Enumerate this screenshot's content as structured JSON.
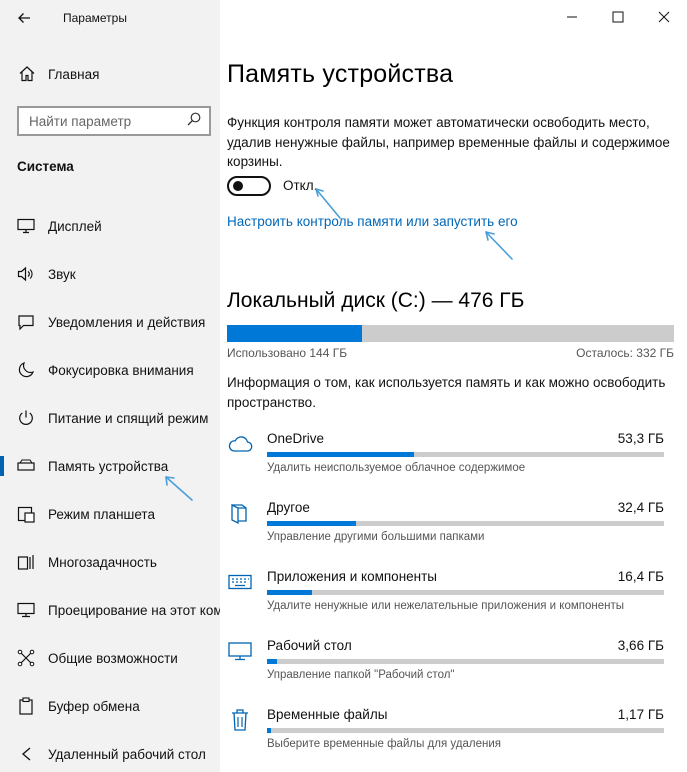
{
  "app": {
    "title": "Параметры"
  },
  "sidebar": {
    "home_label": "Главная",
    "search_placeholder": "Найти параметр",
    "section_title": "Система",
    "items": [
      {
        "label": "Дисплей",
        "icon": "display-icon"
      },
      {
        "label": "Звук",
        "icon": "speaker-icon"
      },
      {
        "label": "Уведомления и действия",
        "icon": "notification-icon"
      },
      {
        "label": "Фокусировка внимания",
        "icon": "moon-icon"
      },
      {
        "label": "Питание и спящий режим",
        "icon": "power-icon"
      },
      {
        "label": "Память устройства",
        "icon": "storage-icon",
        "active": true
      },
      {
        "label": "Режим планшета",
        "icon": "tablet-icon"
      },
      {
        "label": "Многозадачность",
        "icon": "multitask-icon"
      },
      {
        "label": "Проецирование на этот компьютер",
        "icon": "projection-icon"
      },
      {
        "label": "Общие возможности",
        "icon": "shared-icon"
      },
      {
        "label": "Буфер обмена",
        "icon": "clipboard-icon"
      },
      {
        "label": "Удаленный рабочий стол",
        "icon": "remote-desktop-icon"
      }
    ]
  },
  "main": {
    "title": "Память устройства",
    "description": "Функция контроля памяти может автоматически освободить место, удалив ненужные файлы, например временные файлы и содержимое корзины.",
    "toggle_state": "Откл.",
    "link_label": "Настроить контроль памяти или запустить его",
    "disk": {
      "title": "Локальный диск (C:) — 476 ГБ",
      "used_label": "Использовано 144 ГБ",
      "free_label": "Осталось: 332 ГБ",
      "used_fraction": 0.303
    },
    "info_text": "Информация о том, как используется память и как можно освободить пространство.",
    "categories": [
      {
        "name": "OneDrive",
        "size": "53,3 ГБ",
        "sub": "Удалить неиспользуемое облачное содержимое",
        "fraction": 0.37,
        "icon": "cloud-icon"
      },
      {
        "name": "Другое",
        "size": "32,4 ГБ",
        "sub": "Управление другими большими папками",
        "fraction": 0.225,
        "icon": "folder-icon"
      },
      {
        "name": "Приложения и компоненты",
        "size": "16,4 ГБ",
        "sub": "Удалите ненужные или нежелательные приложения и компоненты",
        "fraction": 0.114,
        "icon": "keyboard-icon"
      },
      {
        "name": "Рабочий стол",
        "size": "3,66 ГБ",
        "sub": "Управление папкой \"Рабочий стол\"",
        "fraction": 0.026,
        "icon": "monitor-icon"
      },
      {
        "name": "Временные файлы",
        "size": "1,17 ГБ",
        "sub": "Выберите временные файлы для удаления",
        "fraction": 0.009,
        "icon": "trash-icon"
      }
    ]
  },
  "colors": {
    "accent": "#0078d7",
    "link": "#0067b8",
    "sidebar_bg": "#f2f2f2",
    "bar_bg": "#cccccc",
    "annotation": "#4a9fd8"
  }
}
